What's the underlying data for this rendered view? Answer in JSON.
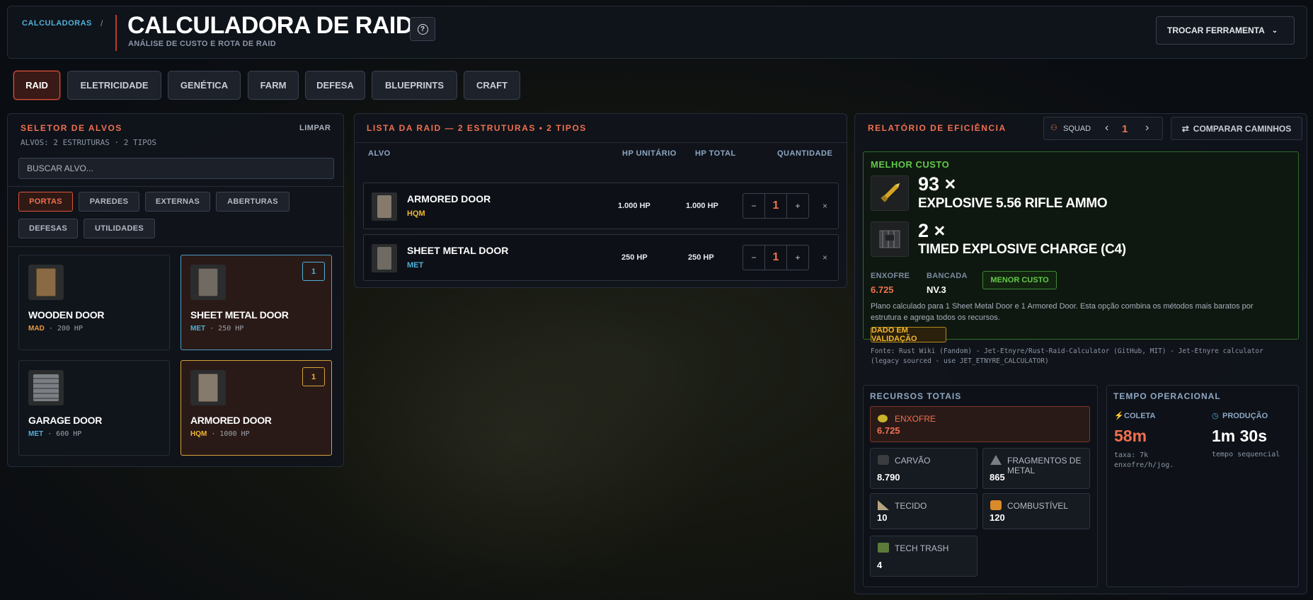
{
  "header": {
    "breadcrumb": "CALCULADORAS",
    "separator": "/",
    "title": "CALCULADORA DE RAID",
    "subtitle": "ANÁLISE DE CUSTO E ROTA DE RAID",
    "help_icon": "question-circle-icon",
    "switch_tool": "TROCAR FERRAMENTA"
  },
  "tabs": [
    "RAID",
    "ELETRICIDADE",
    "GENÉTICA",
    "FARM",
    "DEFESA",
    "BLUEPRINTS",
    "CRAFT"
  ],
  "selector": {
    "title": "SELETOR DE ALVOS",
    "clear": "LIMPAR",
    "summary": "ALVOS: 2 ESTRUTURAS · 2 TIPOS",
    "search_placeholder": "BUSCAR ALVO...",
    "categories": [
      "PORTAS",
      "PAREDES",
      "EXTERNAS",
      "ABERTURAS",
      "DEFESAS",
      "UTILIDADES"
    ],
    "items": [
      {
        "name": "WOODEN DOOR",
        "mat": "MAD",
        "hp": "200 HP",
        "count": ""
      },
      {
        "name": "SHEET METAL DOOR",
        "mat": "MET",
        "hp": "250 HP",
        "count": "1"
      },
      {
        "name": "GARAGE DOOR",
        "mat": "MET",
        "hp": "600 HP",
        "count": ""
      },
      {
        "name": "ARMORED DOOR",
        "mat": "HQM",
        "hp": "1000 HP",
        "count": "1"
      }
    ]
  },
  "raid_list": {
    "title": "LISTA DA RAID — 2 ESTRUTURAS  •  2 TIPOS",
    "cols": [
      "ALVO",
      "HP UNITÁRIO",
      "HP TOTAL",
      "QUANTIDADE"
    ],
    "rows": [
      {
        "name": "ARMORED DOOR",
        "mat": "HQM",
        "unit_hp": "1.000 HP",
        "total_hp": "1.000 HP",
        "qty": "1"
      },
      {
        "name": "SHEET METAL DOOR",
        "mat": "MET",
        "unit_hp": "250 HP",
        "total_hp": "250 HP",
        "qty": "1"
      }
    ],
    "minus": "−",
    "plus": "+",
    "remove": "×"
  },
  "report": {
    "title": "RELATÓRIO DE EFICIÊNCIA",
    "squad_label": "SQUAD",
    "squad_value": "1",
    "prev": "‹",
    "next": "›",
    "compare": "COMPARAR CAMINHOS",
    "best_title": "MELHOR CUSTO",
    "items": [
      {
        "qty": "93 ×",
        "name": "EXPLOSIVE 5.56 RIFLE AMMO"
      },
      {
        "qty": "2 ×",
        "name": "TIMED EXPLOSIVE CHARGE (C4)"
      }
    ],
    "sulfur_label": "ENXOFRE",
    "sulfur_value": "6.725",
    "bench_label": "BANCADA",
    "bench_value": "NV.3",
    "cheapest": "MENOR CUSTO",
    "description": "Plano calculado para 1 Sheet Metal Door e 1 Armored Door. Esta opção combina os métodos mais baratos por estrutura e agrega todos os recursos.",
    "validation": "DADO EM VALIDAÇÃO",
    "source": "Fonte: Rust Wiki (Fandom) - Jet-Etnyre/Rust-Raid-Calculator (GitHub, MIT) - Jet-Etnyre calculator (legacy sourced - use JET_ETNYRE_CALCULATOR)"
  },
  "resources": {
    "title": "RECURSOS TOTAIS",
    "sulfur": {
      "label": "ENXOFRE",
      "value": "6.725"
    },
    "list": [
      {
        "label": "CARVÃO",
        "value": "8.790"
      },
      {
        "label": "FRAGMENTOS DE METAL",
        "value": "865"
      },
      {
        "label": "TECIDO",
        "value": "10"
      },
      {
        "label": "COMBUSTÍVEL",
        "value": "120"
      },
      {
        "label": "TECH TRASH",
        "value": "4"
      }
    ]
  },
  "time": {
    "title": "TEMPO OPERACIONAL",
    "collect_label": "COLETA",
    "collect_value": "58m",
    "collect_note": "taxa: 7k enxofre/h/jog.",
    "prod_label": "PRODUÇÃO",
    "prod_value": "1m 30s",
    "prod_note": "tempo sequencial"
  },
  "colors": {
    "accent": "#f0704f",
    "hqm": "#f2b730",
    "met": "#4fb0d8",
    "mad": "#e89a3c",
    "green": "#63c94a"
  }
}
